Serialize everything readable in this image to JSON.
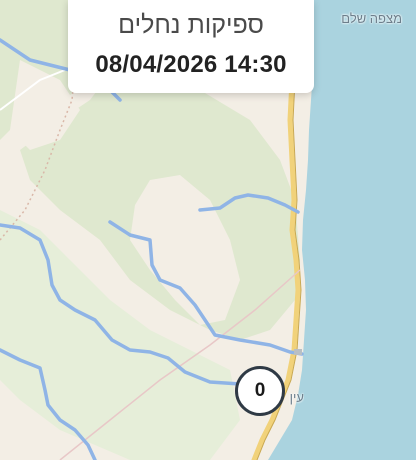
{
  "map": {
    "place_label_north": "מצפה שלם",
    "place_label_south": "עין",
    "colors": {
      "land": "#f3eee5",
      "vegetation": "#dfe8cf",
      "sea": "#aad3df",
      "river": "#8fb4e6",
      "road": "#f1d27a",
      "marker_border": "#2f3a45"
    }
  },
  "info_card": {
    "title": "ספיקות נחלים",
    "datetime": "08/04/2026 14:30"
  },
  "station_marker": {
    "count": "0"
  }
}
